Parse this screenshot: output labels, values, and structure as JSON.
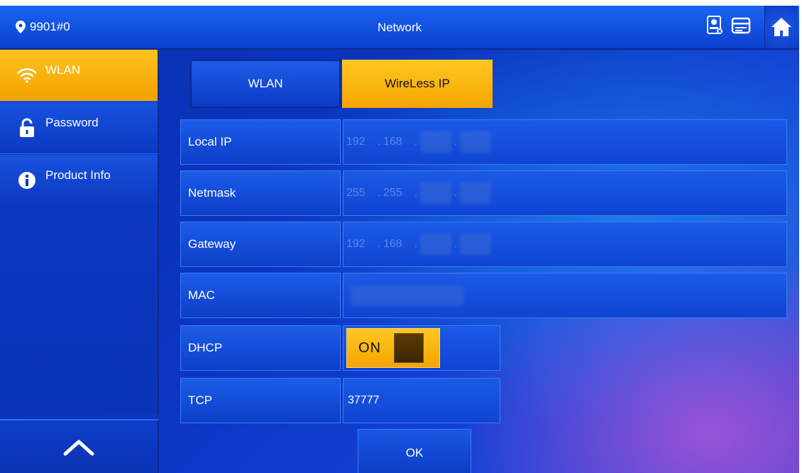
{
  "header": {
    "device_id": "9901#0",
    "title": "Network",
    "icons": [
      "contact-card-icon",
      "message-icon",
      "home-icon"
    ]
  },
  "sidebar": {
    "items": [
      {
        "label": "WLAN",
        "icon": "wifi-icon",
        "active": true
      },
      {
        "label": "Password",
        "icon": "lock-icon",
        "active": false
      },
      {
        "label": "Product Info",
        "icon": "info-icon",
        "active": false
      }
    ],
    "up_icon": "chevron-up-icon"
  },
  "tabs": [
    {
      "label": "WLAN",
      "active": false
    },
    {
      "label": "WireLess IP",
      "active": true
    }
  ],
  "form": {
    "local_ip": {
      "label": "Local IP",
      "seg1": "192",
      "seg2": "168"
    },
    "netmask": {
      "label": "Netmask",
      "seg1": "255",
      "seg2": "255"
    },
    "gateway": {
      "label": "Gateway",
      "seg1": "192",
      "seg2": "168"
    },
    "mac": {
      "label": "MAC"
    },
    "dhcp": {
      "label": "DHCP",
      "state": "ON"
    },
    "tcp": {
      "label": "TCP",
      "value": "37777"
    }
  },
  "ok_label": "OK",
  "colors": {
    "accent": "#f6a400",
    "primary": "#0b3bc6"
  }
}
